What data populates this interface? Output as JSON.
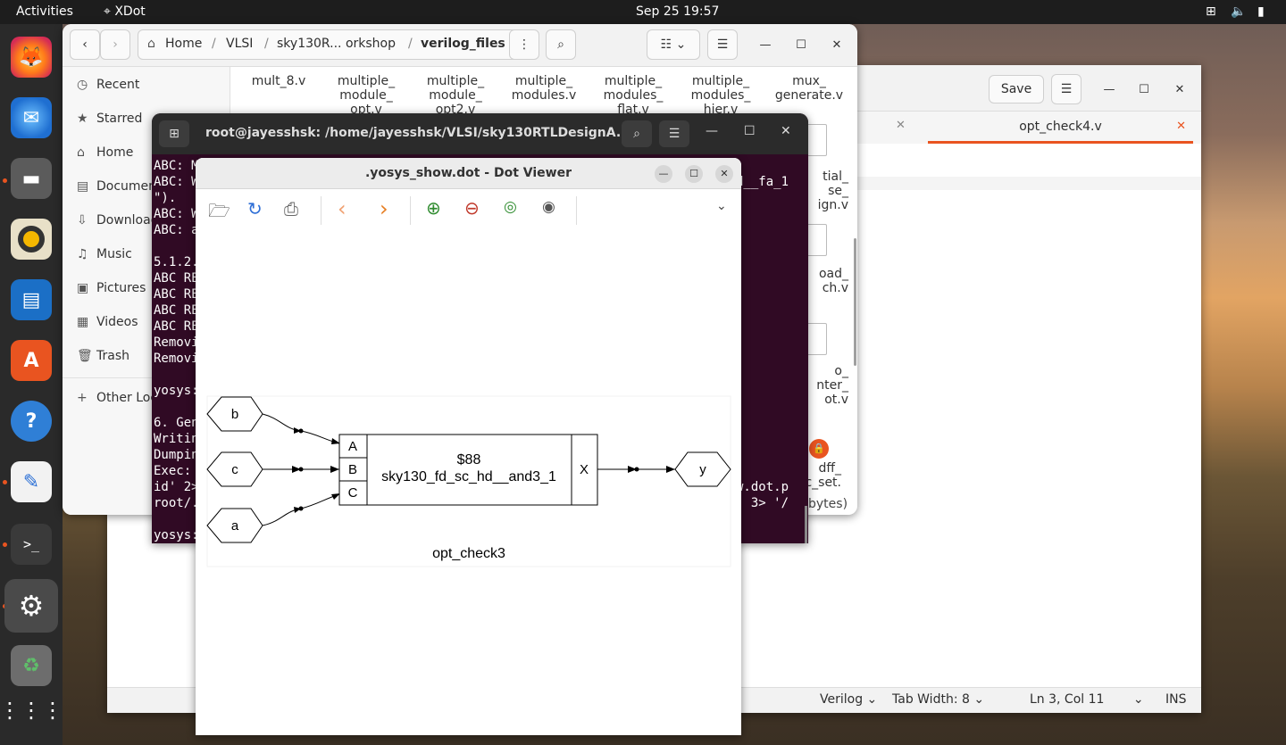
{
  "topbar": {
    "activities": "Activities",
    "app_name": "XDot",
    "datetime": "Sep 25  19:57"
  },
  "dock": {
    "items": [
      "firefox-icon",
      "thunderbird-icon",
      "files-icon",
      "rhythmbox-icon",
      "writer-icon",
      "software-icon",
      "help-icon",
      "text-editor-icon",
      "terminal-icon",
      "settings-icon",
      "trash-icon",
      "apps-grid-icon"
    ]
  },
  "files": {
    "path": [
      "Home",
      "VLSI",
      "sky130R... orkshop",
      "verilog_files"
    ],
    "sidebar": [
      "Recent",
      "Starred",
      "Home",
      "Documents",
      "Downloads",
      "Music",
      "Pictures",
      "Videos",
      "Trash",
      "Other Locations"
    ],
    "row1": [
      "mult_8.v",
      "multiple_\nmodule_\nopt.v",
      "multiple_\nmodule_\nopt2.v",
      "multiple_\nmodules.v",
      "multiple_\nmodules_\nflat.v",
      "multiple_\nmodules_\nhier.v",
      "mux_\ngenerate.v"
    ],
    "right_col": [
      "tial_\nse_\nign.v",
      "oad_\nch.v",
      "o_\nnter_\not.v",
      "dff_\nc_set."
    ],
    "status": "bytes)"
  },
  "editor": {
    "save": "Save",
    "tab_active": "opt_check4.v",
    "language": "Verilog",
    "tab_width": "Tab Width: 8",
    "position": "Ln 3, Col 11",
    "mode": "INS"
  },
  "terminal": {
    "title": "root@jayesshsk: /home/jayesshsk/VLSI/sky130RTLDesignA...",
    "lines": [
      "ABC: M",
      "ABC: W",
      "\").",
      "ABC: W",
      "ABC: a",
      "",
      "5.1.2.",
      "ABC RE",
      "ABC RE",
      "ABC RE",
      "ABC RE",
      "Removi",
      "Removi",
      "",
      "yosys:",
      "",
      "6. Gen",
      "Writin",
      "Dumpin",
      "Exec: ",
      "id' 2>",
      "root/.",
      "",
      "yosys:"
    ],
    "right_frag": [
      "d__fa_1",
      ".",
      "",
      "",
      "",
      "",
      "",
      "",
      "",
      "",
      "",
      "",
      "",
      "",
      "",
      "",
      "",
      "",
      "",
      "w.dot.p",
      ") 3> '/",
      ""
    ]
  },
  "dotviewer": {
    "title": ".yosys_show.dot - Dot Viewer",
    "graph": {
      "inputs": [
        "b",
        "c",
        "a"
      ],
      "cell_id": "$88",
      "cell_type": "sky130_fd_sc_hd__and3_1",
      "ports_in": [
        "A",
        "B",
        "C"
      ],
      "port_out": "X",
      "output": "y",
      "module": "opt_check3"
    }
  },
  "colors": {
    "accent": "#e95420",
    "terminal_bg": "#300a24",
    "topbar": "#1d1d1d"
  }
}
